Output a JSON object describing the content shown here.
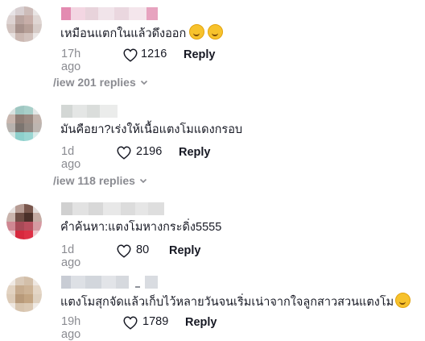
{
  "comments": [
    {
      "text": "เหมือนแตกในแล้วดึงออก",
      "emojis": [
        "rolling-laughing-emoji",
        "rolling-laughing-emoji"
      ],
      "time": "17h ago",
      "likes": "1216",
      "reply_label": "Reply",
      "view_replies": "/iew 201 replies"
    },
    {
      "text": "มันคือยา?เร่งให้เนื้อแตงโมแดงกรอบ",
      "emojis": [],
      "time": "1d ago",
      "likes": "2196",
      "reply_label": "Reply",
      "view_replies": "/iew 118 replies"
    },
    {
      "text": "คำค้นหา:แตงโมหางกระดิ่ง5555",
      "emojis": [],
      "time": "1d ago",
      "likes": "80",
      "reply_label": "Reply",
      "view_replies": ""
    },
    {
      "text": "แตงโมสุกจัดแล้วเก็บไว้หลายวันจนเริ่มเน่าจากใจลูกสาวสวนแตงโม",
      "emojis": [
        "smiling-face-emoji"
      ],
      "time": "19h ago",
      "likes": "1789",
      "reply_label": "Reply",
      "view_replies": ""
    }
  ],
  "icons": {
    "like": "heart-outline-icon",
    "expand": "chevron-down-icon"
  },
  "colors": {
    "primary_text": "#161823",
    "secondary_text": "#8a8b91",
    "emoji": "#f7c22c"
  }
}
